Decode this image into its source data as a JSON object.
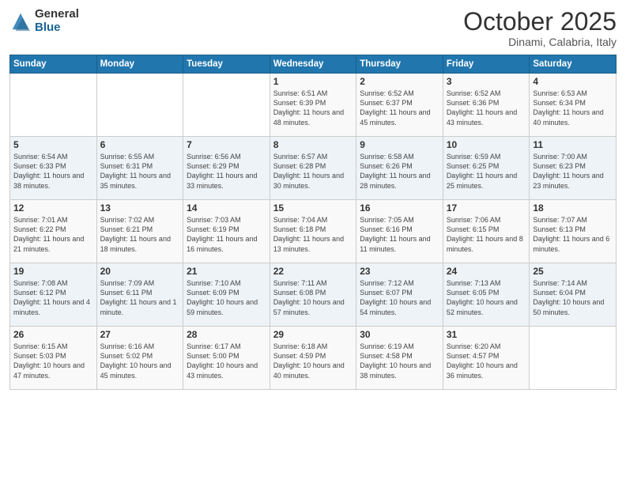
{
  "logo": {
    "general": "General",
    "blue": "Blue"
  },
  "header": {
    "month": "October 2025",
    "location": "Dinami, Calabria, Italy"
  },
  "weekdays": [
    "Sunday",
    "Monday",
    "Tuesday",
    "Wednesday",
    "Thursday",
    "Friday",
    "Saturday"
  ],
  "weeks": [
    [
      {
        "day": "",
        "sunrise": "",
        "sunset": "",
        "daylight": ""
      },
      {
        "day": "",
        "sunrise": "",
        "sunset": "",
        "daylight": ""
      },
      {
        "day": "",
        "sunrise": "",
        "sunset": "",
        "daylight": ""
      },
      {
        "day": "1",
        "sunrise": "Sunrise: 6:51 AM",
        "sunset": "Sunset: 6:39 PM",
        "daylight": "Daylight: 11 hours and 48 minutes."
      },
      {
        "day": "2",
        "sunrise": "Sunrise: 6:52 AM",
        "sunset": "Sunset: 6:37 PM",
        "daylight": "Daylight: 11 hours and 45 minutes."
      },
      {
        "day": "3",
        "sunrise": "Sunrise: 6:52 AM",
        "sunset": "Sunset: 6:36 PM",
        "daylight": "Daylight: 11 hours and 43 minutes."
      },
      {
        "day": "4",
        "sunrise": "Sunrise: 6:53 AM",
        "sunset": "Sunset: 6:34 PM",
        "daylight": "Daylight: 11 hours and 40 minutes."
      }
    ],
    [
      {
        "day": "5",
        "sunrise": "Sunrise: 6:54 AM",
        "sunset": "Sunset: 6:33 PM",
        "daylight": "Daylight: 11 hours and 38 minutes."
      },
      {
        "day": "6",
        "sunrise": "Sunrise: 6:55 AM",
        "sunset": "Sunset: 6:31 PM",
        "daylight": "Daylight: 11 hours and 35 minutes."
      },
      {
        "day": "7",
        "sunrise": "Sunrise: 6:56 AM",
        "sunset": "Sunset: 6:29 PM",
        "daylight": "Daylight: 11 hours and 33 minutes."
      },
      {
        "day": "8",
        "sunrise": "Sunrise: 6:57 AM",
        "sunset": "Sunset: 6:28 PM",
        "daylight": "Daylight: 11 hours and 30 minutes."
      },
      {
        "day": "9",
        "sunrise": "Sunrise: 6:58 AM",
        "sunset": "Sunset: 6:26 PM",
        "daylight": "Daylight: 11 hours and 28 minutes."
      },
      {
        "day": "10",
        "sunrise": "Sunrise: 6:59 AM",
        "sunset": "Sunset: 6:25 PM",
        "daylight": "Daylight: 11 hours and 25 minutes."
      },
      {
        "day": "11",
        "sunrise": "Sunrise: 7:00 AM",
        "sunset": "Sunset: 6:23 PM",
        "daylight": "Daylight: 11 hours and 23 minutes."
      }
    ],
    [
      {
        "day": "12",
        "sunrise": "Sunrise: 7:01 AM",
        "sunset": "Sunset: 6:22 PM",
        "daylight": "Daylight: 11 hours and 21 minutes."
      },
      {
        "day": "13",
        "sunrise": "Sunrise: 7:02 AM",
        "sunset": "Sunset: 6:21 PM",
        "daylight": "Daylight: 11 hours and 18 minutes."
      },
      {
        "day": "14",
        "sunrise": "Sunrise: 7:03 AM",
        "sunset": "Sunset: 6:19 PM",
        "daylight": "Daylight: 11 hours and 16 minutes."
      },
      {
        "day": "15",
        "sunrise": "Sunrise: 7:04 AM",
        "sunset": "Sunset: 6:18 PM",
        "daylight": "Daylight: 11 hours and 13 minutes."
      },
      {
        "day": "16",
        "sunrise": "Sunrise: 7:05 AM",
        "sunset": "Sunset: 6:16 PM",
        "daylight": "Daylight: 11 hours and 11 minutes."
      },
      {
        "day": "17",
        "sunrise": "Sunrise: 7:06 AM",
        "sunset": "Sunset: 6:15 PM",
        "daylight": "Daylight: 11 hours and 8 minutes."
      },
      {
        "day": "18",
        "sunrise": "Sunrise: 7:07 AM",
        "sunset": "Sunset: 6:13 PM",
        "daylight": "Daylight: 11 hours and 6 minutes."
      }
    ],
    [
      {
        "day": "19",
        "sunrise": "Sunrise: 7:08 AM",
        "sunset": "Sunset: 6:12 PM",
        "daylight": "Daylight: 11 hours and 4 minutes."
      },
      {
        "day": "20",
        "sunrise": "Sunrise: 7:09 AM",
        "sunset": "Sunset: 6:11 PM",
        "daylight": "Daylight: 11 hours and 1 minute."
      },
      {
        "day": "21",
        "sunrise": "Sunrise: 7:10 AM",
        "sunset": "Sunset: 6:09 PM",
        "daylight": "Daylight: 10 hours and 59 minutes."
      },
      {
        "day": "22",
        "sunrise": "Sunrise: 7:11 AM",
        "sunset": "Sunset: 6:08 PM",
        "daylight": "Daylight: 10 hours and 57 minutes."
      },
      {
        "day": "23",
        "sunrise": "Sunrise: 7:12 AM",
        "sunset": "Sunset: 6:07 PM",
        "daylight": "Daylight: 10 hours and 54 minutes."
      },
      {
        "day": "24",
        "sunrise": "Sunrise: 7:13 AM",
        "sunset": "Sunset: 6:05 PM",
        "daylight": "Daylight: 10 hours and 52 minutes."
      },
      {
        "day": "25",
        "sunrise": "Sunrise: 7:14 AM",
        "sunset": "Sunset: 6:04 PM",
        "daylight": "Daylight: 10 hours and 50 minutes."
      }
    ],
    [
      {
        "day": "26",
        "sunrise": "Sunrise: 6:15 AM",
        "sunset": "Sunset: 5:03 PM",
        "daylight": "Daylight: 10 hours and 47 minutes."
      },
      {
        "day": "27",
        "sunrise": "Sunrise: 6:16 AM",
        "sunset": "Sunset: 5:02 PM",
        "daylight": "Daylight: 10 hours and 45 minutes."
      },
      {
        "day": "28",
        "sunrise": "Sunrise: 6:17 AM",
        "sunset": "Sunset: 5:00 PM",
        "daylight": "Daylight: 10 hours and 43 minutes."
      },
      {
        "day": "29",
        "sunrise": "Sunrise: 6:18 AM",
        "sunset": "Sunset: 4:59 PM",
        "daylight": "Daylight: 10 hours and 40 minutes."
      },
      {
        "day": "30",
        "sunrise": "Sunrise: 6:19 AM",
        "sunset": "Sunset: 4:58 PM",
        "daylight": "Daylight: 10 hours and 38 minutes."
      },
      {
        "day": "31",
        "sunrise": "Sunrise: 6:20 AM",
        "sunset": "Sunset: 4:57 PM",
        "daylight": "Daylight: 10 hours and 36 minutes."
      },
      {
        "day": "",
        "sunrise": "",
        "sunset": "",
        "daylight": ""
      }
    ]
  ]
}
